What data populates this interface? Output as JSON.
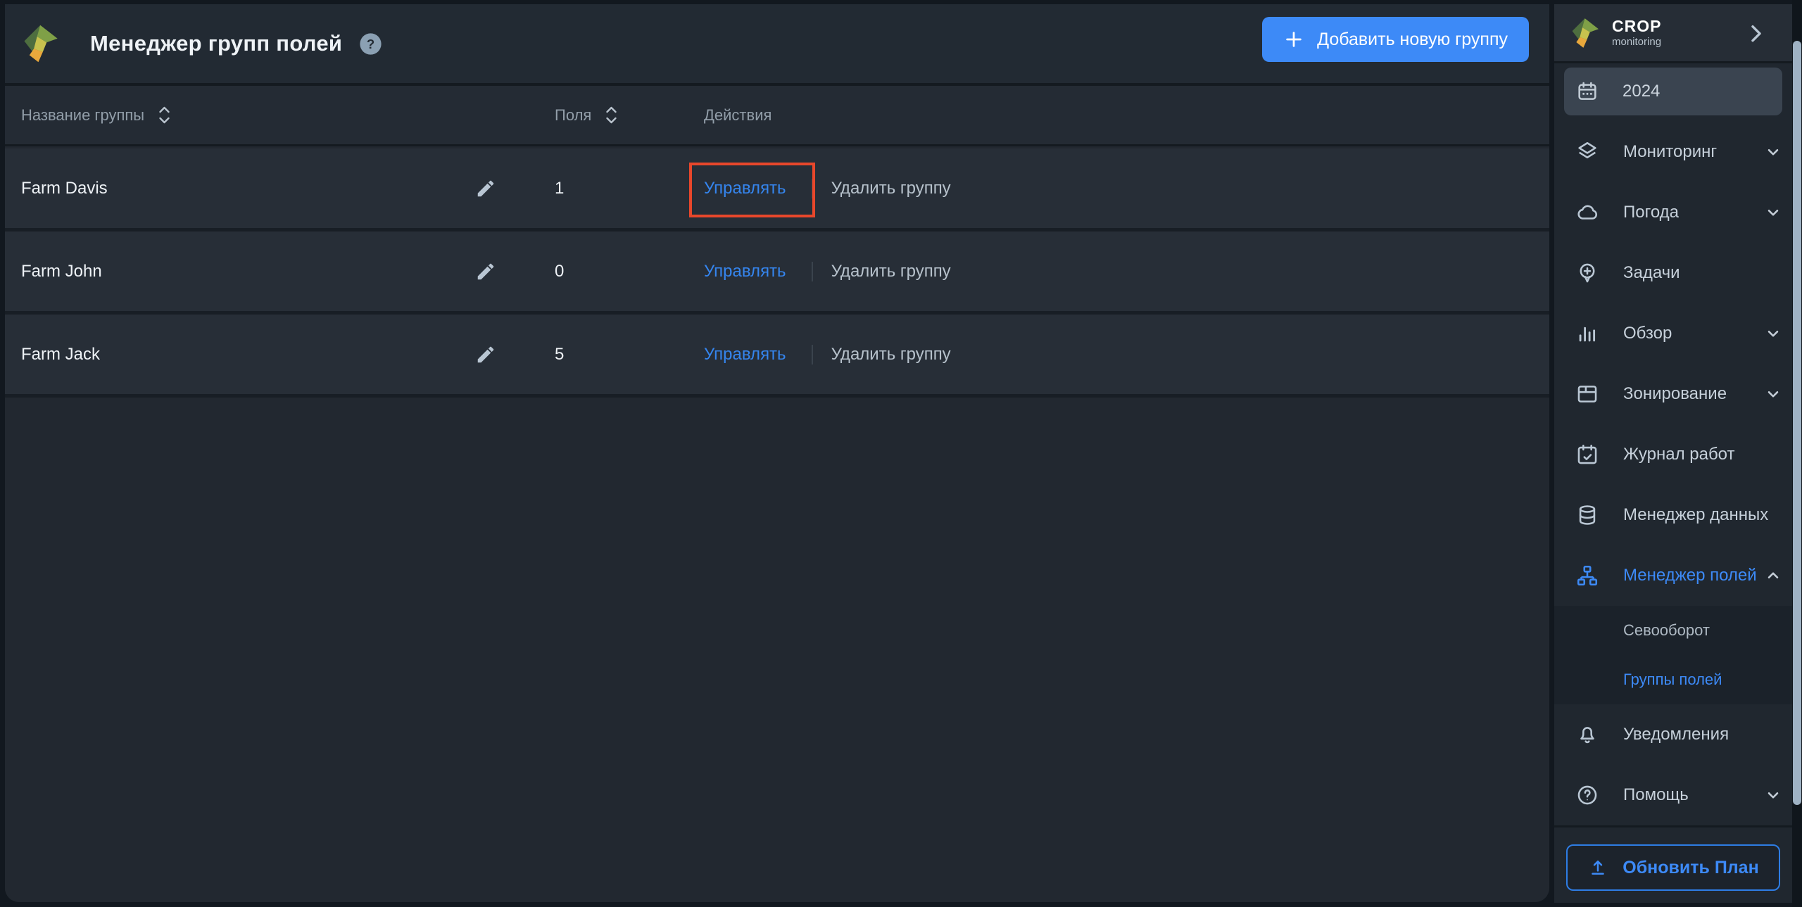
{
  "colors": {
    "page-bg": "#12181f",
    "panel-header-bg": "#222a33",
    "table-header-bg": "#242b34",
    "row-bg": "#272e37",
    "table-empty-bg": "#222830",
    "sidebar-bg": "#20272f",
    "sidebar-header-bg": "#262d36",
    "sidebar-selected-bg": "#3a4450",
    "submenu-bg": "#1b222a",
    "accent-blue": "#3d8af7",
    "link-blue": "#3585ee",
    "highlight-red": "#e8472b",
    "text-primary": "#eef2f6",
    "text-muted": "#929ea9",
    "text-label": "#c6d0da",
    "icon-color": "#bac7d4",
    "scrollbar-thumb": "#9fb2c4",
    "divider": "#141a20"
  },
  "header": {
    "title": "Менеджер групп полей",
    "add_button": "Добавить новую группу"
  },
  "table": {
    "columns": {
      "name": "Название группы",
      "fields": "Поля",
      "actions": "Действия"
    },
    "rows": [
      {
        "name": "Farm Davis",
        "fields": "1",
        "manage": "Управлять",
        "delete": "Удалить группу"
      },
      {
        "name": "Farm John",
        "fields": "0",
        "manage": "Управлять",
        "delete": "Удалить группу"
      },
      {
        "name": "Farm Jack",
        "fields": "5",
        "manage": "Управлять",
        "delete": "Удалить группу"
      }
    ],
    "highlight": {
      "row": 0,
      "target": "manage-link"
    }
  },
  "sidebar": {
    "brand": {
      "name": "CROP",
      "tagline": "monitoring"
    },
    "year": "2024",
    "items": [
      {
        "label": "Мониторинг",
        "expandable": true
      },
      {
        "label": "Погода",
        "expandable": true
      },
      {
        "label": "Задачи",
        "expandable": false
      },
      {
        "label": "Обзор",
        "expandable": true
      },
      {
        "label": "Зонирование",
        "expandable": true
      },
      {
        "label": "Журнал работ",
        "expandable": false
      },
      {
        "label": "Менеджер данных",
        "expandable": false
      },
      {
        "label": "Менеджер полей",
        "expandable": true,
        "expanded": true,
        "active": true
      }
    ],
    "submenu": [
      {
        "label": "Севооборот",
        "active": false
      },
      {
        "label": "Группы полей",
        "active": true
      }
    ],
    "bottom_items": [
      {
        "label": "Уведомления",
        "expandable": false
      },
      {
        "label": "Помощь",
        "expandable": true
      }
    ],
    "upgrade_label": "Обновить План"
  }
}
